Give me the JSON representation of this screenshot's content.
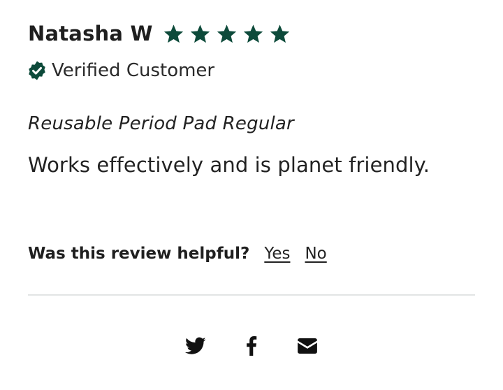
{
  "review": {
    "reviewer_name": "Natasha W",
    "rating": 5,
    "rating_max": 5,
    "verified_label": "Verified Customer",
    "product_name": "Reusable Period Pad Regular",
    "body": "Works effectively and is planet friendly.",
    "helpful": {
      "question": "Was this review helpful?",
      "yes_label": "Yes",
      "no_label": "No"
    }
  },
  "share": {
    "icons": [
      "twitter-icon",
      "facebook-icon",
      "email-icon"
    ]
  },
  "colors": {
    "accent": "#0d4a3a",
    "text": "#1f1f1f",
    "divider": "#e2e5e4",
    "icon": "#111111"
  }
}
